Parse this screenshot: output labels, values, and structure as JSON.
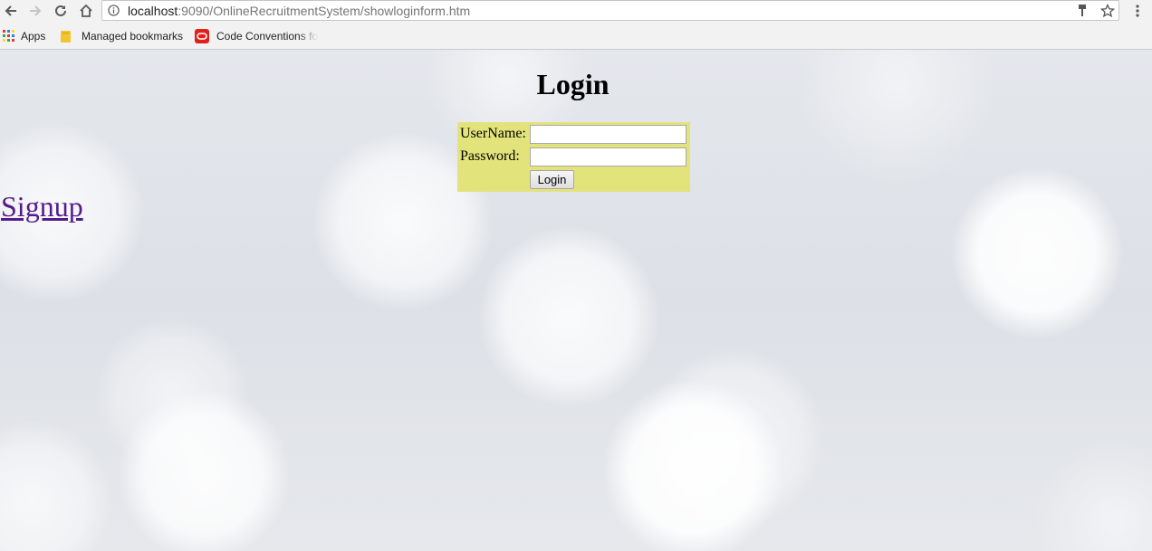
{
  "browser": {
    "url_host": "localhost",
    "url_port_path": ":9090/OnlineRecruitmentSystem/showloginform.htm",
    "bookmarks": [
      {
        "label": "Apps",
        "icon": "apps-grid-icon"
      },
      {
        "label": "Managed bookmarks",
        "icon": "folder-icon"
      },
      {
        "label": "Code Conventions fo",
        "icon": "oracle-icon"
      }
    ]
  },
  "page": {
    "heading": "Login",
    "username_label": "UserName:",
    "password_label": "Password:",
    "username_value": "",
    "password_value": "",
    "login_button": "Login",
    "signup_link": "Signup"
  },
  "colors": {
    "form_background": "#e3e37b",
    "visited_link": "#551a8b"
  }
}
